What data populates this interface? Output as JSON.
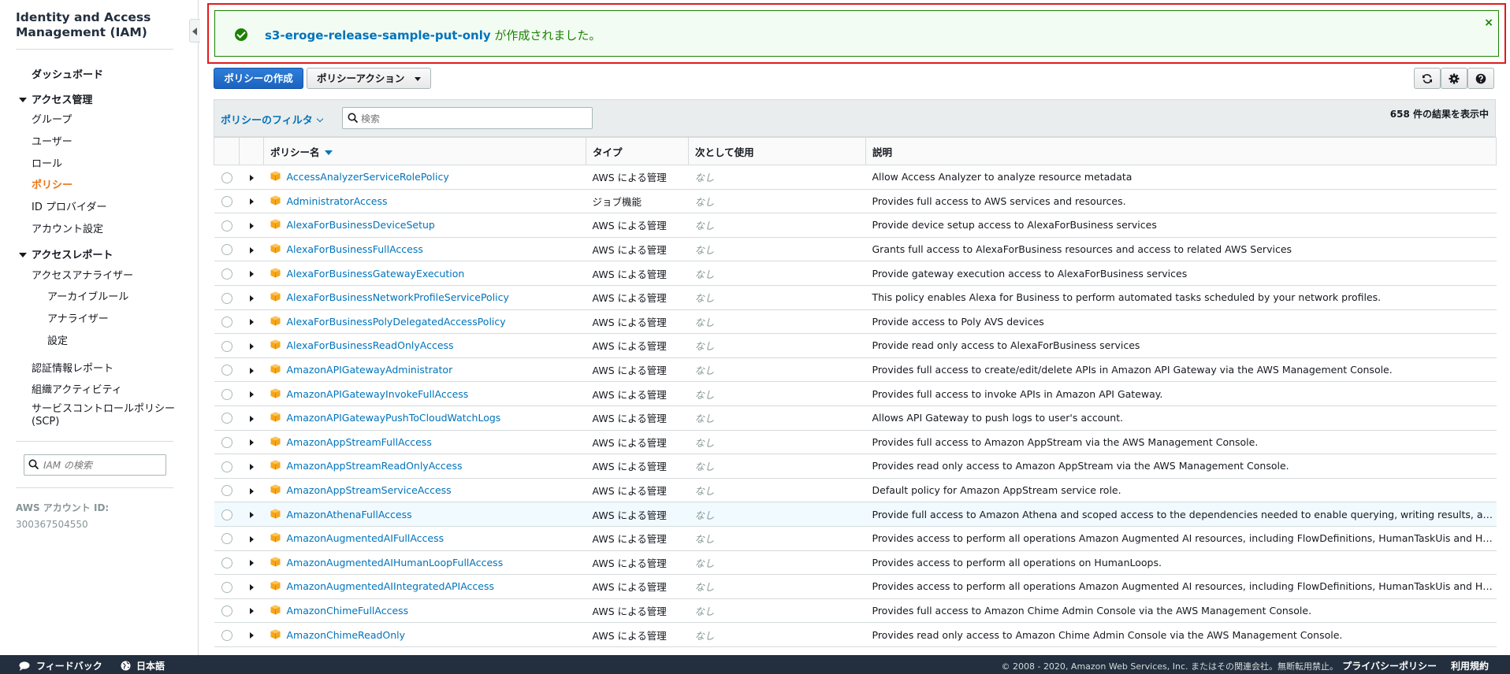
{
  "sidebar": {
    "title": "Identity and Access Management (IAM)",
    "dashboard": "ダッシュボード",
    "access_management": {
      "label": "アクセス管理",
      "items": [
        "グループ",
        "ユーザー",
        "ロール",
        "ポリシー",
        "ID プロバイダー",
        "アカウント設定"
      ]
    },
    "access_reports": {
      "label": "アクセスレポート",
      "analyzer": "アクセスアナライザー",
      "sub_items": [
        "アーカイブルール",
        "アナライザー",
        "設定"
      ],
      "items": [
        "認証情報レポート",
        "組織アクティビティ",
        "サービスコントロールポリシー (SCP)"
      ]
    },
    "search_placeholder": "IAM の検索",
    "account_label": "AWS アカウント ID:",
    "account_id": "300367504550"
  },
  "flash": {
    "policy_name": "s3-eroge-release-sample-put-only",
    "message": " が作成されました。",
    "close": "×"
  },
  "toolbar": {
    "create_label": "ポリシーの作成",
    "actions_label": "ポリシーアクション"
  },
  "filter": {
    "label": "ポリシーのフィルタ",
    "search_placeholder": "検索",
    "result_count": "658 件の結果を表示中"
  },
  "table": {
    "columns": [
      "ポリシー名",
      "タイプ",
      "次として使用",
      "説明"
    ],
    "rows": [
      {
        "name": "AccessAnalyzerServiceRolePolicy",
        "type": "AWS による管理",
        "used_as": "なし",
        "description": "Allow Access Analyzer to analyze resource metadata"
      },
      {
        "name": "AdministratorAccess",
        "type": "ジョブ機能",
        "used_as": "なし",
        "description": "Provides full access to AWS services and resources."
      },
      {
        "name": "AlexaForBusinessDeviceSetup",
        "type": "AWS による管理",
        "used_as": "なし",
        "description": "Provide device setup access to AlexaForBusiness services"
      },
      {
        "name": "AlexaForBusinessFullAccess",
        "type": "AWS による管理",
        "used_as": "なし",
        "description": "Grants full access to AlexaForBusiness resources and access to related AWS Services"
      },
      {
        "name": "AlexaForBusinessGatewayExecution",
        "type": "AWS による管理",
        "used_as": "なし",
        "description": "Provide gateway execution access to AlexaForBusiness services"
      },
      {
        "name": "AlexaForBusinessNetworkProfileServicePolicy",
        "type": "AWS による管理",
        "used_as": "なし",
        "description": "This policy enables Alexa for Business to perform automated tasks scheduled by your network profiles."
      },
      {
        "name": "AlexaForBusinessPolyDelegatedAccessPolicy",
        "type": "AWS による管理",
        "used_as": "なし",
        "description": "Provide access to Poly AVS devices"
      },
      {
        "name": "AlexaForBusinessReadOnlyAccess",
        "type": "AWS による管理",
        "used_as": "なし",
        "description": "Provide read only access to AlexaForBusiness services"
      },
      {
        "name": "AmazonAPIGatewayAdministrator",
        "type": "AWS による管理",
        "used_as": "なし",
        "description": "Provides full access to create/edit/delete APIs in Amazon API Gateway via the AWS Management Console."
      },
      {
        "name": "AmazonAPIGatewayInvokeFullAccess",
        "type": "AWS による管理",
        "used_as": "なし",
        "description": "Provides full access to invoke APIs in Amazon API Gateway."
      },
      {
        "name": "AmazonAPIGatewayPushToCloudWatchLogs",
        "type": "AWS による管理",
        "used_as": "なし",
        "description": "Allows API Gateway to push logs to user's account."
      },
      {
        "name": "AmazonAppStreamFullAccess",
        "type": "AWS による管理",
        "used_as": "なし",
        "description": "Provides full access to Amazon AppStream via the AWS Management Console."
      },
      {
        "name": "AmazonAppStreamReadOnlyAccess",
        "type": "AWS による管理",
        "used_as": "なし",
        "description": "Provides read only access to Amazon AppStream via the AWS Management Console."
      },
      {
        "name": "AmazonAppStreamServiceAccess",
        "type": "AWS による管理",
        "used_as": "なし",
        "description": "Default policy for Amazon AppStream service role."
      },
      {
        "name": "AmazonAthenaFullAccess",
        "type": "AWS による管理",
        "used_as": "なし",
        "description": "Provide full access to Amazon Athena and scoped access to the dependencies needed to enable querying, writing results, and data man..."
      },
      {
        "name": "AmazonAugmentedAIFullAccess",
        "type": "AWS による管理",
        "used_as": "なし",
        "description": "Provides access to perform all operations Amazon Augmented AI resources, including FlowDefinitions, HumanTaskUis and HumanLoops..."
      },
      {
        "name": "AmazonAugmentedAIHumanLoopFullAccess",
        "type": "AWS による管理",
        "used_as": "なし",
        "description": "Provides access to perform all operations on HumanLoops."
      },
      {
        "name": "AmazonAugmentedAIIntegratedAPIAccess",
        "type": "AWS による管理",
        "used_as": "なし",
        "description": "Provides access to perform all operations Amazon Augmented AI resources, including FlowDefinitions, HumanTaskUis and HumanLoops..."
      },
      {
        "name": "AmazonChimeFullAccess",
        "type": "AWS による管理",
        "used_as": "なし",
        "description": "Provides full access to Amazon Chime Admin Console via the AWS Management Console."
      },
      {
        "name": "AmazonChimeReadOnly",
        "type": "AWS による管理",
        "used_as": "なし",
        "description": "Provides read only access to Amazon Chime Admin Console via the AWS Management Console."
      }
    ]
  },
  "footer": {
    "feedback": "フィードバック",
    "language": "日本語",
    "copyright": "© 2008 - 2020, Amazon Web Services, Inc. またはその関連会社。無断転用禁止。",
    "privacy": "プライバシーポリシー",
    "terms": "利用規約"
  },
  "colors": {
    "accent_orange": "#ec7211",
    "link_blue": "#0073bb",
    "success_green": "#1d8102",
    "highlight_border": "#e01b1b",
    "footer_bg": "#232f3e"
  }
}
